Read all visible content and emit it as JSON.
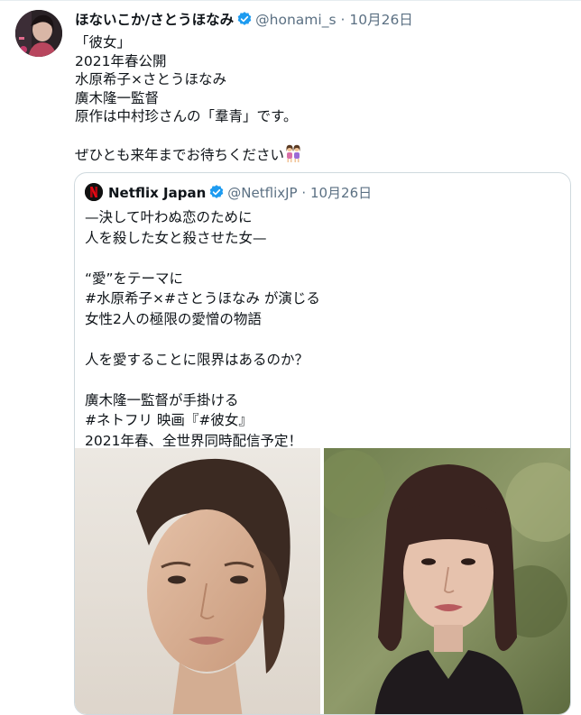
{
  "tweet": {
    "author_name": "ほないこか/さとうほなみ",
    "handle": "@honami_s",
    "separator": "·",
    "time": "10月26日",
    "text": "「彼女」\n2021年春公開\n水原希子×さとうほなみ\n廣木隆一監督\n原作は中村珍さんの「羣青」です。\n\nぜひとも来年までお待ちください",
    "emoji": "two-women-emoji"
  },
  "quoted_tweet": {
    "author_name": "Netflix Japan",
    "handle": "@NetflixJP",
    "separator": "·",
    "time": "10月26日",
    "text": "—決して叶わぬ恋のために\n 人を殺した女と殺させた女—\n\n“愛”をテーマに\n#水原希子×#さとうほなみ が演じる\n女性2人の極限の愛憎の物語\n\n人を愛することに限界はあるのか？\n\n廣木隆一監督が手掛ける\n#ネトフリ 映画『#彼女』\n2021年春、全世界同時配信予定！"
  },
  "colors": {
    "text": "#0f1419",
    "secondary": "#5b7083",
    "verified": "#1d9bf0",
    "border": "#cfd9de",
    "netflix_red": "#e50914"
  }
}
